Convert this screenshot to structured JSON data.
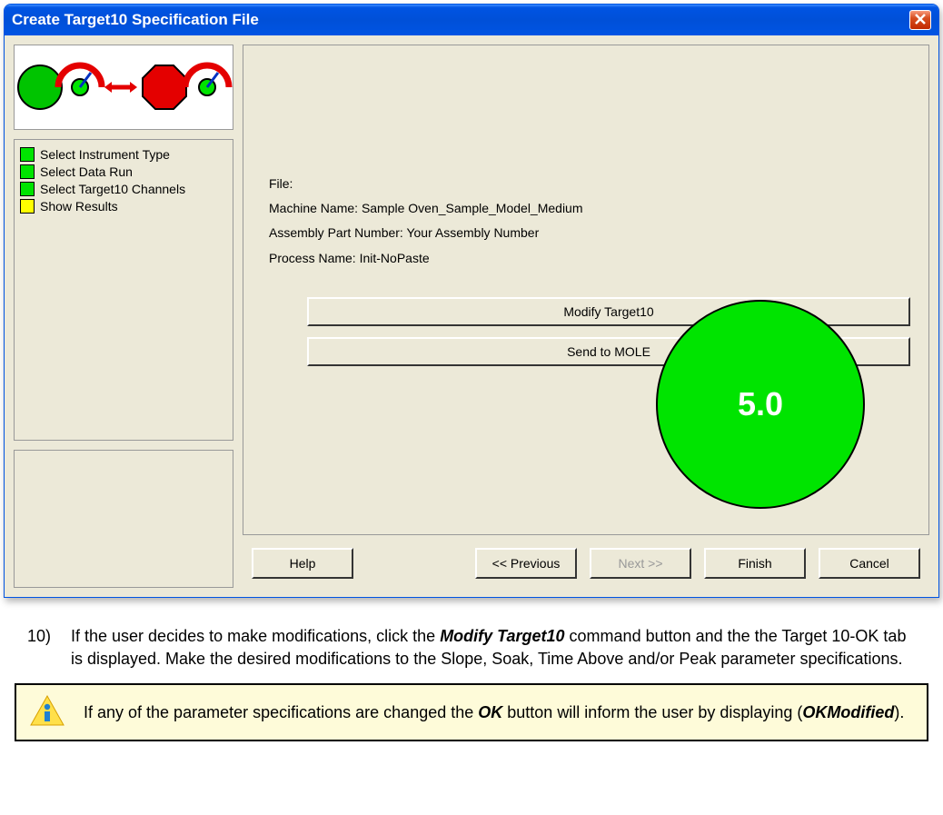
{
  "dialog": {
    "title": "Create Target10 Specification File",
    "steps": [
      {
        "label": "Select Instrument Type",
        "status": "green"
      },
      {
        "label": "Select Data Run",
        "status": "green"
      },
      {
        "label": "Select Target10 Channels",
        "status": "green"
      },
      {
        "label": "Show Results",
        "status": "yellow"
      }
    ],
    "info": {
      "file_label": "File:",
      "file_value": "",
      "machine_label": "Machine Name:",
      "machine_value": "Sample Oven_Sample_Model_Medium",
      "assembly_label": "Assembly Part Number:",
      "assembly_value": "Your Assembly Number",
      "process_label": "Process Name:",
      "process_value": "Init-NoPaste"
    },
    "actions": {
      "modify_label": "Modify Target10",
      "send_label": "Send to MOLE"
    },
    "score": "5.0",
    "nav": {
      "help": "Help",
      "previous": "<< Previous",
      "next": "Next >>",
      "finish": "Finish",
      "cancel": "Cancel"
    }
  },
  "doc": {
    "step_num": "10)",
    "step_text_1": "If the user decides to make modifications, click the ",
    "step_bold_1": "Modify Target10",
    "step_text_2": " command button and the the Target 10-OK tab is displayed. Make the desired modifications to the Slope, Soak, Time Above and/or Peak parameter specifications.",
    "note_text_1": "If any of the parameter specifications are changed the ",
    "note_bold_1": "OK",
    "note_text_2": " button will inform the user by displaying (",
    "note_bold_2": "OKModified",
    "note_text_3": ")."
  }
}
